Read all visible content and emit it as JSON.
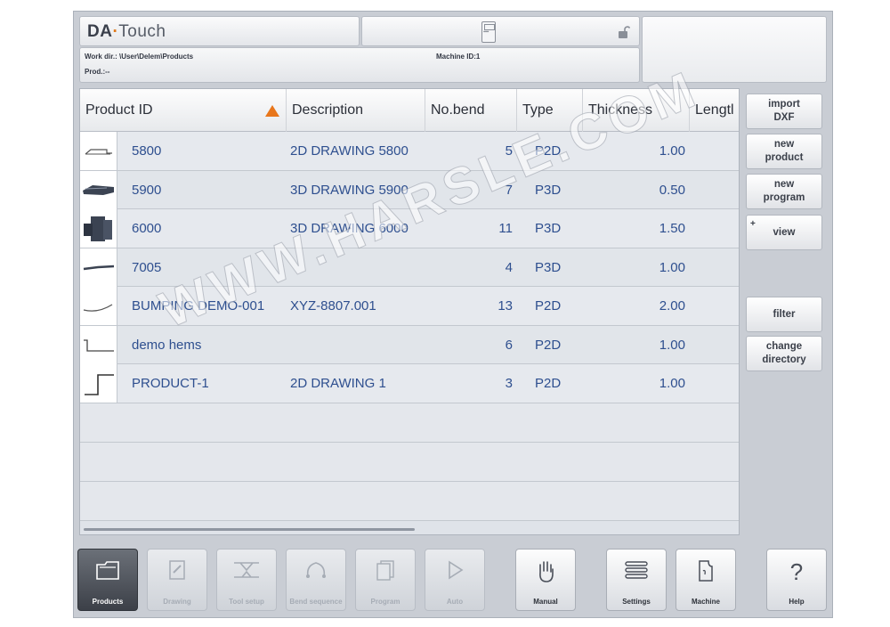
{
  "header": {
    "logo_da": "DA",
    "logo_dot": "·",
    "logo_touch": "Touch",
    "work_dir": "Work dir.: \\User\\Delem\\Products",
    "machine_id": "Machine ID:1",
    "prod": "Prod.:--"
  },
  "table": {
    "columns": [
      "Product ID",
      "Description",
      "No.bend",
      "Type",
      "Thickness",
      "Lengtl"
    ],
    "rows": [
      {
        "id": "5800",
        "description": "2D DRAWING 5800",
        "bends": "5",
        "type": "P2D",
        "thickness": "1.00"
      },
      {
        "id": "5900",
        "description": "3D DRAWING 5900",
        "bends": "7",
        "type": "P3D",
        "thickness": "0.50"
      },
      {
        "id": "6000",
        "description": "3D DRAWING 6000",
        "bends": "11",
        "type": "P3D",
        "thickness": "1.50"
      },
      {
        "id": "7005",
        "description": "",
        "bends": "4",
        "type": "P3D",
        "thickness": "1.00"
      },
      {
        "id": "BUMPING DEMO-001",
        "description": "XYZ-8807.001",
        "bends": "13",
        "type": "P2D",
        "thickness": "2.00"
      },
      {
        "id": "demo hems",
        "description": "",
        "bends": "6",
        "type": "P2D",
        "thickness": "1.00"
      },
      {
        "id": "PRODUCT-1",
        "description": "2D DRAWING 1",
        "bends": "3",
        "type": "P2D",
        "thickness": "1.00"
      }
    ]
  },
  "side_buttons": {
    "import_dxf": [
      "import",
      "DXF"
    ],
    "new_product": [
      "new",
      "product"
    ],
    "new_program": [
      "new",
      "program"
    ],
    "view": "view",
    "view_marker": "+",
    "filter": "filter",
    "change_directory": [
      "change",
      "directory"
    ]
  },
  "nav": {
    "products": "Products",
    "drawing": "Drawing",
    "tool_setup": "Tool setup",
    "bend_sequence": "Bend sequence",
    "program": "Program",
    "auto": "Auto",
    "manual": "Manual",
    "settings": "Settings",
    "machine": "Machine",
    "help": "Help",
    "help_glyph": "?"
  },
  "watermark": "WWW.HARSLE.COM",
  "colors": {
    "accent": "#e8761b",
    "link_text": "#2e4f8f",
    "panel_bg": "#c9cdd4"
  }
}
